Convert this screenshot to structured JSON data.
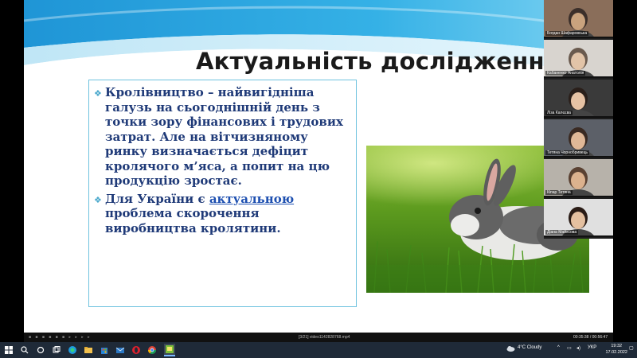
{
  "slide": {
    "title": "Актуальність дослідження",
    "bullets": [
      {
        "parts": [
          {
            "text": "Кролівництво – найвигідніша галузь на сьогоднішній день з точки зору фінансових і трудових затрат. Але на вітчизняному ринку визначається дефіцит кролячого м’яса, а попит на цю продукцію зростає.",
            "link": false
          }
        ]
      },
      {
        "parts": [
          {
            "text": "Для України є ",
            "link": false
          },
          {
            "text": "актуальною",
            "link": true
          },
          {
            "text": " проблема скорочення виробництва кролятини.",
            "link": false
          }
        ]
      }
    ],
    "bullet_glyph": "❖"
  },
  "participants": [
    {
      "name": "Богдан Шафаровська"
    },
    {
      "name": "Кабаненко Анатолія"
    },
    {
      "name": "Ліза Калєєва"
    },
    {
      "name": "Тетяна Чорнобривець"
    },
    {
      "name": "Кіпар Тетяна"
    },
    {
      "name": "Діана Майхсова"
    }
  ],
  "media_bar": {
    "title": "[3/21] video1142828768.mp4",
    "time": "00:35:38 / 00:56:47",
    "left_controls": "■ ■ ■ ■ ■ ■ ▸ ▸ ▸ ▸"
  },
  "taskbar": {
    "weather": "4°C  Cloudy",
    "language": "УКР",
    "time": "19:32",
    "date": "17.02.2022"
  },
  "colors": {
    "title_bar_blue": "#2a9fd8",
    "bullet_text": "#1f3a78",
    "taskbar": "#1f2a38"
  }
}
